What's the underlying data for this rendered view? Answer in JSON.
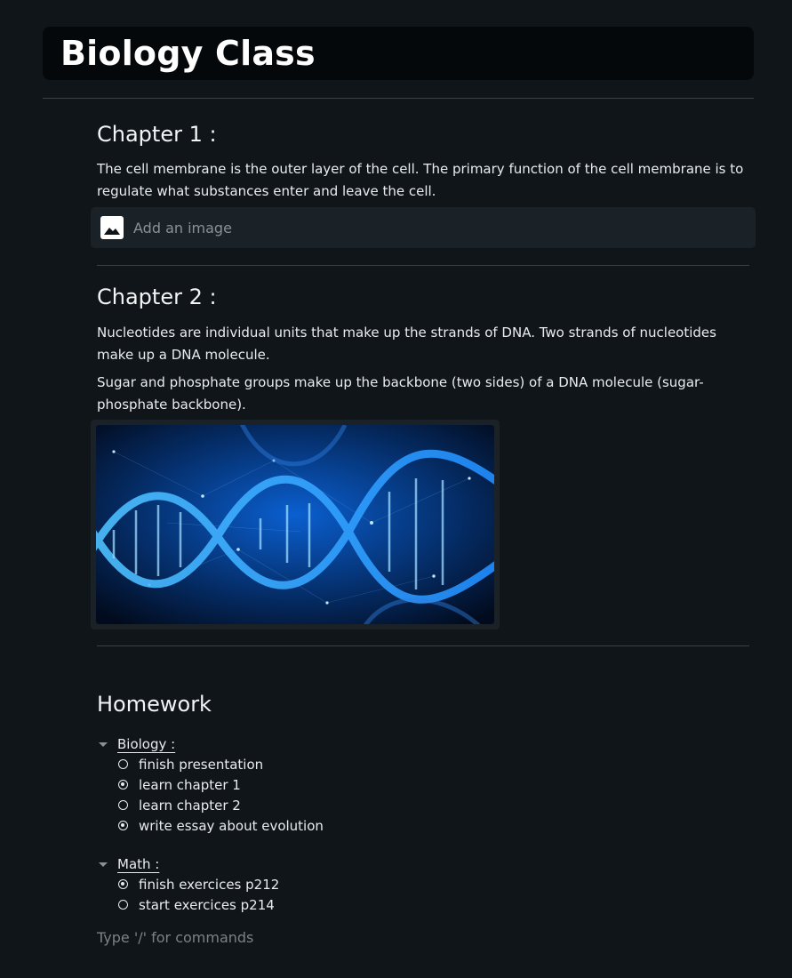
{
  "page": {
    "title": "Biology Class"
  },
  "chapters": [
    {
      "heading": "Chapter 1 :",
      "paragraphs": [
        "The cell membrane is the outer layer of the cell. The primary function of the cell membrane is to regulate what substances enter and leave the cell."
      ],
      "add_image_label": "Add an image"
    },
    {
      "heading": "Chapter 2 :",
      "paragraphs": [
        "Nucleotides are individual units that make up the strands of DNA. Two strands of nucleotides make up a DNA molecule.",
        "Sugar and phosphate groups make up the backbone (two sides) of a DNA molecule (sugar-phosphate backbone)."
      ]
    }
  ],
  "homework": {
    "heading": "Homework",
    "groups": [
      {
        "label": "Biology :",
        "tasks": [
          {
            "text": "finish presentation",
            "done": false
          },
          {
            "text": "learn chapter 1",
            "done": true
          },
          {
            "text": "learn chapter 2",
            "done": false
          },
          {
            "text": "write essay about evolution",
            "done": true
          }
        ]
      },
      {
        "label": "Math :",
        "tasks": [
          {
            "text": "finish exercices p212",
            "done": true
          },
          {
            "text": "start exercices p214",
            "done": false
          }
        ]
      }
    ]
  },
  "editor": {
    "placeholder": "Type '/' for commands"
  },
  "colors": {
    "background": "#101519",
    "title_bar": "#05080a",
    "card": "#1b2227",
    "text": "#e9ecef",
    "muted": "#8a9096"
  },
  "icons": {
    "add_image": "image-icon",
    "group_toggle": "caret-down-icon",
    "task": "radio-icon"
  }
}
